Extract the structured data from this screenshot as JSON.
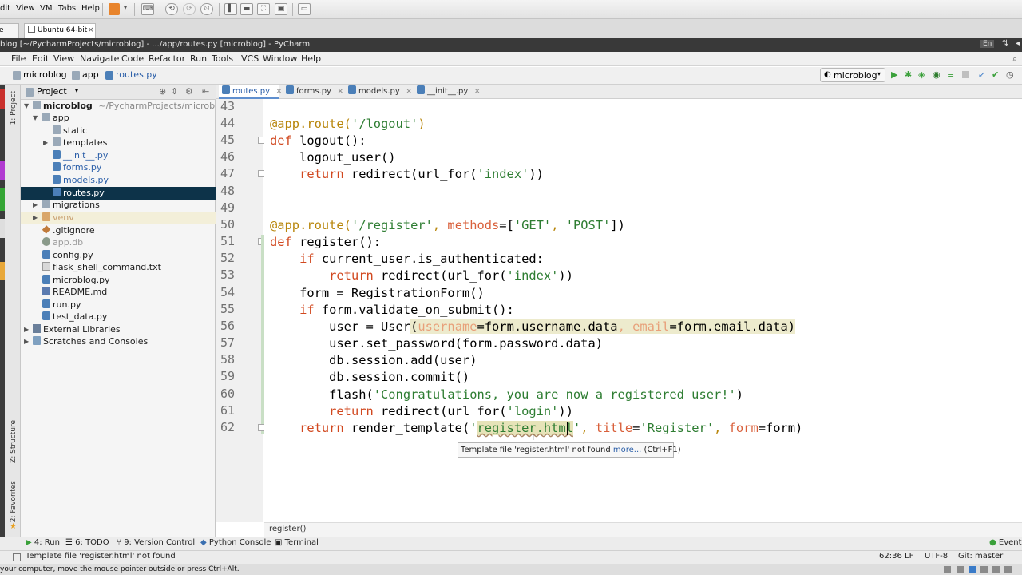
{
  "vm": {
    "menus": [
      "dit",
      "View",
      "VM",
      "Tabs",
      "Help"
    ],
    "tabs": [
      "e",
      "Ubuntu 64-bit"
    ],
    "hint": "your computer, move the mouse pointer outside or press Ctrl+Alt."
  },
  "pycharm": {
    "title": "blog [~/PycharmProjects/microblog] - .../app/routes.py [microblog] - PyCharm",
    "lang_badge": "En",
    "menus": [
      "File",
      "Edit",
      "View",
      "Navigate",
      "Code",
      "Refactor",
      "Run",
      "Tools",
      "VCS",
      "Window",
      "Help"
    ],
    "breadcrumbs": [
      "microblog",
      "app",
      "routes.py"
    ],
    "run_config": "microblog",
    "side_tabs": [
      "1: Project",
      "Z: Structure",
      "2: Favorites"
    ]
  },
  "project": {
    "header": "Project",
    "tree": [
      {
        "label": "microblog",
        "suffix": "~/PycharmProjects/microblog",
        "icon": "folder-icon"
      },
      {
        "label": "app",
        "icon": "folder-icon"
      },
      {
        "label": "static",
        "icon": "folder-icon"
      },
      {
        "label": "templates",
        "icon": "folder-icon"
      },
      {
        "label": "__init__.py",
        "icon": "python-file-icon"
      },
      {
        "label": "forms.py",
        "icon": "python-file-icon"
      },
      {
        "label": "models.py",
        "icon": "python-file-icon"
      },
      {
        "label": "routes.py",
        "icon": "python-file-icon"
      },
      {
        "label": "migrations",
        "icon": "folder-icon"
      },
      {
        "label": "venv",
        "icon": "folder-icon"
      },
      {
        "label": ".gitignore",
        "icon": "git-file-icon"
      },
      {
        "label": "app.db",
        "icon": "database-file-icon"
      },
      {
        "label": "config.py",
        "icon": "python-file-icon"
      },
      {
        "label": "flask_shell_command.txt",
        "icon": "text-file-icon"
      },
      {
        "label": "microblog.py",
        "icon": "python-file-icon"
      },
      {
        "label": "README.md",
        "icon": "markdown-file-icon"
      },
      {
        "label": "run.py",
        "icon": "python-file-icon"
      },
      {
        "label": "test_data.py",
        "icon": "python-file-icon"
      },
      {
        "label": "External Libraries",
        "icon": "library-icon"
      },
      {
        "label": "Scratches and Consoles",
        "icon": "scratch-icon"
      }
    ]
  },
  "editor": {
    "tabs": [
      "routes.py",
      "forms.py",
      "models.py",
      "__init__.py"
    ],
    "line_numbers": [
      "43",
      "44",
      "45",
      "46",
      "47",
      "48",
      "49",
      "50",
      "51",
      "52",
      "53",
      "54",
      "55",
      "56",
      "57",
      "58",
      "59",
      "60",
      "61",
      "62"
    ],
    "tokens": {
      "l44_dec": "@app.route(",
      "l44_str": "'/logout'",
      "l44_end": ")",
      "def": "def ",
      "l45_name": "logout",
      "l45_end": "():",
      "l46": "logout_user()",
      "ret": "return ",
      "l47_a": "redirect(url_for(",
      "l47_str": "'index'",
      "l47_end": "))",
      "l50_dec": "@app.route(",
      "l50_str1": "'/register'",
      "l50_comma": ", ",
      "l50_prm": "methods",
      "l50_eq": "=[",
      "l50_str2": "'GET'",
      "l50_comma2": ", ",
      "l50_str3": "'POST'",
      "l50_end": "])",
      "l51_name": "register",
      "l51_end": "():",
      "if": "if ",
      "l52_rest": "current_user.is_authenticated:",
      "l53_a": "redirect(url_for(",
      "l53_str": "'index'",
      "l53_end": "))",
      "l54": "form = RegistrationForm()",
      "l55_rest": "form.validate_on_submit():",
      "l56_a": "user = User",
      "l56_p": "(",
      "l56_prm1": "username",
      "l56_v1": "=form.username.data",
      "l56_c": ", ",
      "l56_prm2": "email",
      "l56_v2": "=form.email.data",
      "l56_end": ")",
      "l57": "user.set_password(form.password.data)",
      "l58": "db.session.add(user)",
      "l59": "db.session.commit()",
      "l60_a": "flash(",
      "l60_str": "'Congratulations, you are now a registered user!'",
      "l60_end": ")",
      "l61_a": "redirect(url_for(",
      "l61_str": "'login'",
      "l61_end": "))",
      "l62_a": "render_template(",
      "l62_q": "'",
      "l62_hl": "register.html",
      "l62_q2": "'",
      "l62_c": ", ",
      "l62_prm1": "title",
      "l62_eq": "=",
      "l62_str": "'Register'",
      "l62_c2": ", ",
      "l62_prm2": "form",
      "l62_v": "=form)"
    },
    "tooltip_main": "Template file 'register.html' not found ",
    "tooltip_more": "more...",
    "tooltip_shortcut": " (Ctrl+F1)",
    "breadcrumb": "register()"
  },
  "toolwindows": [
    "4: Run",
    "6: TODO",
    "9: Version Control",
    "Python Console",
    "Terminal"
  ],
  "event_log": "Event",
  "status": {
    "message": "Template file 'register.html' not found",
    "position": "62:36",
    "line_sep": "LF",
    "encoding": "UTF-8",
    "git": "Git: master"
  }
}
